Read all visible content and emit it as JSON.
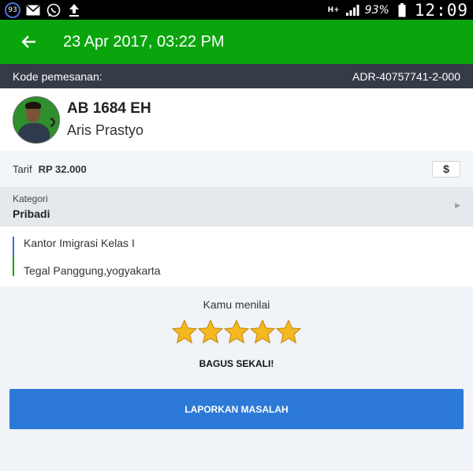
{
  "status_bar": {
    "notification_count": "93",
    "network_label": "H+",
    "battery": "93%",
    "time": "12:09"
  },
  "app_bar": {
    "title": "23 Apr 2017, 03:22 PM"
  },
  "booking": {
    "label": "Kode pemesanan:",
    "code": "ADR-40757741-2-000"
  },
  "driver": {
    "plate": "AB 1684 EH",
    "name": "Aris Prastyo"
  },
  "fare": {
    "label": "Tarif",
    "amount": "RP 32.000",
    "button_symbol": "$"
  },
  "category": {
    "label": "Kategori",
    "value": "Pribadi"
  },
  "route": {
    "pickup": "Kantor Imigrasi Kelas I",
    "dropoff": "Tegal Panggung,yogyakarta"
  },
  "rating": {
    "label": "Kamu menilai",
    "stars": 5,
    "max_stars": 5,
    "star_color": "#f5b820",
    "verdict": "BAGUS SEKALI!"
  },
  "actions": {
    "report_label": "LAPORKAN MASALAH"
  },
  "colors": {
    "app_bar": "#0aa50d",
    "booking_bar": "#363b48",
    "report_button": "#2d79d8"
  }
}
